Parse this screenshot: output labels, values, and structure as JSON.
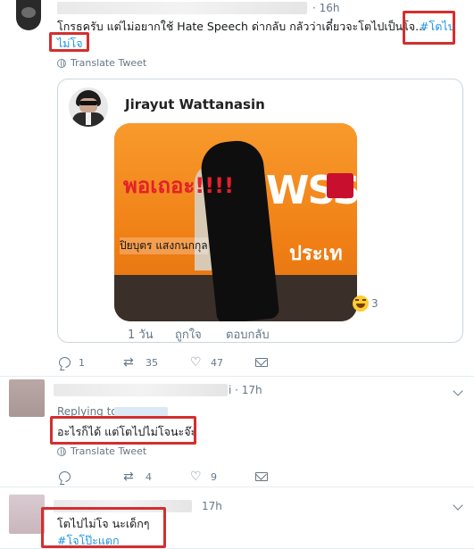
{
  "tweet1": {
    "time": "· 16h",
    "text_line1": "โกรธครับ แต่ไม่อยากใช้ Hate Speech ด่ากลับ กลัวว่าเดี๋ยวจะโตไปเป็นโจ...",
    "hashtag_part1": "#โตไป",
    "hashtag_part2": "ไม่โจ",
    "translate_label": "Translate Tweet",
    "card": {
      "author_name": "Jirayut Wattanasin",
      "photo_caption_red": "พอเถอะ!!!!",
      "photo_caption_black": "ปิยบุตร แสงกนกกุล",
      "photo_logo_text": "WSS",
      "photo_bottom_text": "ประเท",
      "reaction_count": "3",
      "time": "1 วัน",
      "like_label": "ถูกใจ",
      "reply_label": "ตอบกลับ"
    },
    "actions": {
      "reply_count": "1",
      "retweet_count": "35",
      "like_count": "47"
    }
  },
  "tweet2": {
    "time_suffix": "i · 17h",
    "replying_label": "Replying to",
    "text": "อะไรก็ได้ แต่โตไปไม่โจนะจ๊ะ",
    "translate_label": "Translate Tweet",
    "actions": {
      "reply_count": "",
      "retweet_count": "4",
      "like_count": "9"
    }
  },
  "tweet3": {
    "time": "17h",
    "text_line1": "โตไปไม่โจ นะเด็กๆ",
    "hashtag": "#โจโป๊ะแตก"
  },
  "colors": {
    "accent": "#1b95e0",
    "highlight_box": "#d32f2f",
    "muted": "#657786"
  },
  "icons": [
    "reply-icon",
    "retweet-icon",
    "like-icon",
    "message-icon",
    "globe-icon",
    "chevron-down-icon",
    "laughing-emoji-icon"
  ]
}
